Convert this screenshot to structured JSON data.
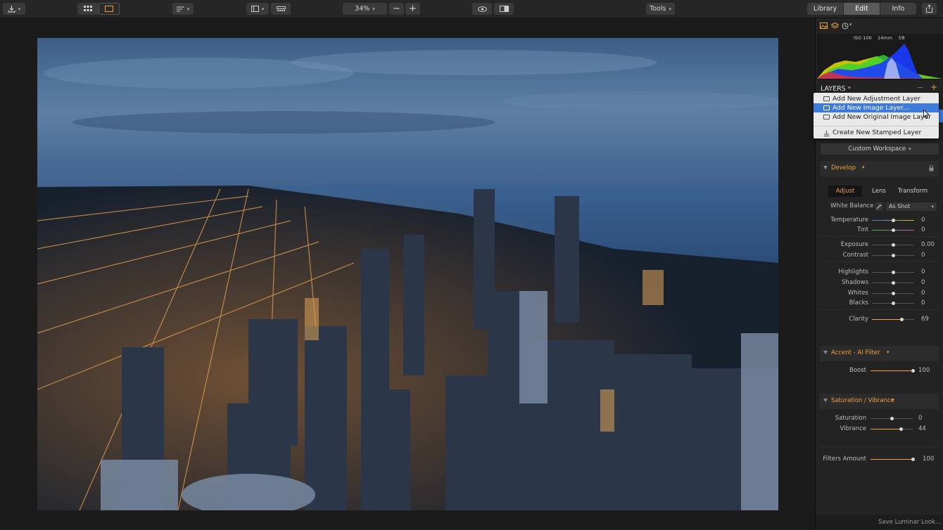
{
  "toolbar": {
    "zoom": "34%",
    "tools_label": "Tools",
    "tabs": [
      {
        "label": "Library"
      },
      {
        "label": "Edit"
      },
      {
        "label": "Info"
      }
    ]
  },
  "histogram": {
    "iso": "ISO 100",
    "focal": "14mm",
    "aperture": "f/8"
  },
  "layers": {
    "title": "LAYERS",
    "menu": [
      {
        "label": "Add New Adjustment Layer"
      },
      {
        "label": "Add New Image Layer..."
      },
      {
        "label": "Add New Original Image Layer"
      },
      {
        "label": "Create New Stamped Layer"
      }
    ]
  },
  "workspace": {
    "label": "Custom Workspace"
  },
  "develop": {
    "title": "Develop",
    "tabs": [
      {
        "label": "Adjust"
      },
      {
        "label": "Lens"
      },
      {
        "label": "Transform"
      }
    ],
    "white_balance": {
      "label": "White Balance",
      "value": "As Shot"
    },
    "sliders": [
      {
        "label": "Temperature",
        "value": "0",
        "pos": 0.5
      },
      {
        "label": "Tint",
        "value": "0",
        "pos": 0.5
      },
      {
        "label": "Exposure",
        "value": "0.00",
        "pos": 0.5
      },
      {
        "label": "Contrast",
        "value": "0",
        "pos": 0.5
      },
      {
        "label": "Highlights",
        "value": "0",
        "pos": 0.5
      },
      {
        "label": "Shadows",
        "value": "0",
        "pos": 0.5
      },
      {
        "label": "Whites",
        "value": "0",
        "pos": 0.5
      },
      {
        "label": "Blacks",
        "value": "0",
        "pos": 0.5
      },
      {
        "label": "Clarity",
        "value": "69",
        "pos": 0.7
      }
    ]
  },
  "accent": {
    "title": "Accent - AI Filter",
    "boost": {
      "label": "Boost",
      "value": "100",
      "pos": 1.0
    }
  },
  "satvib": {
    "title": "Saturation / Vibrance",
    "saturation": {
      "label": "Saturation",
      "value": "0",
      "pos": 0.5
    },
    "vibrance": {
      "label": "Vibrance",
      "value": "44",
      "pos": 0.72
    }
  },
  "filters_amount": {
    "label": "Filters Amount",
    "value": "100",
    "pos": 1.0
  },
  "footer": {
    "save_look": "Save Luminar Look..."
  },
  "colors": {
    "accent": "#f0a13a",
    "menu_highlight": "#3d7ad9"
  }
}
